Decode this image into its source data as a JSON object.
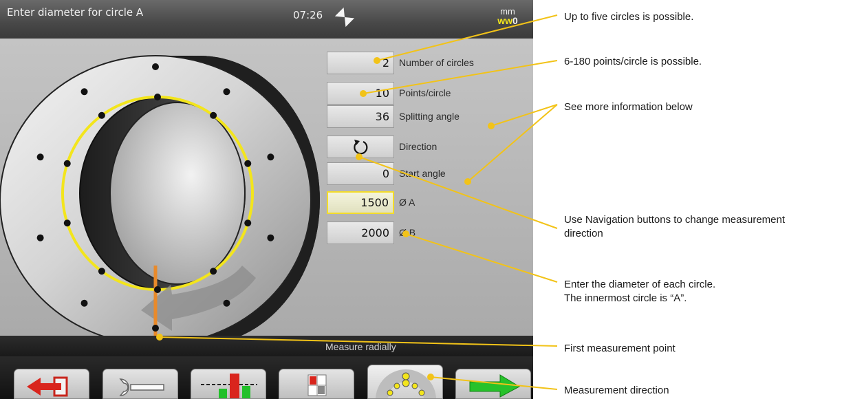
{
  "header": {
    "title": "Enter diameter for circle A",
    "clock": "07:26",
    "unit": "mm",
    "unit_value": "0"
  },
  "fields": [
    {
      "value": "2",
      "label": "Number of circles"
    },
    {
      "value": "10",
      "label": "Points/circle"
    },
    {
      "value": "36",
      "label": "Splitting angle"
    },
    {
      "value": "",
      "label": "Direction",
      "icon": "rotate-icon"
    },
    {
      "value": "0",
      "label": "Start angle"
    },
    {
      "value": "1500",
      "label": "Ø A",
      "active": true
    },
    {
      "value": "2000",
      "label": "Ø B"
    }
  ],
  "status": {
    "text": "Measure radially"
  },
  "toolbar": {
    "buttons": [
      {
        "name": "exit-button",
        "icon": "exit-arrow-icon"
      },
      {
        "name": "settings-button",
        "icon": "wrench-icon"
      },
      {
        "name": "results-button",
        "icon": "bar-chart-icon"
      },
      {
        "name": "view-button",
        "icon": "grid-icon"
      },
      {
        "name": "direction-button",
        "icon": "circle-points-icon"
      },
      {
        "name": "next-button",
        "icon": "next-arrow-icon"
      }
    ]
  },
  "callouts": [
    {
      "text": "Up to five circles is possible."
    },
    {
      "text": "6-180 points/circle is possible."
    },
    {
      "text": "See more information below"
    },
    {
      "line1": "Use Navigation buttons to change measurement",
      "line2": "direction"
    },
    {
      "line1": "Enter the diameter of each circle.",
      "line2": "The innermost circle is “A”."
    },
    {
      "text": "First measurement point"
    },
    {
      "text": "Measurement direction"
    }
  ],
  "colors": {
    "highlight": "#f3e51c",
    "marker": "#e98a2a",
    "callout_line": "#f2c318",
    "titlebar": "#4a4a4a"
  }
}
